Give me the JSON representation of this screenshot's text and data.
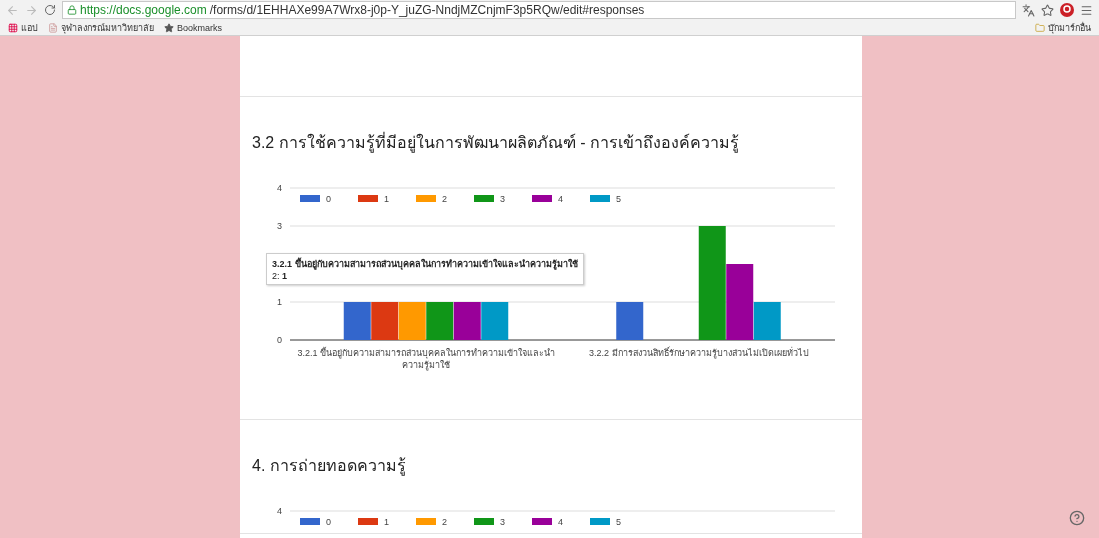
{
  "browser": {
    "url_host": "https://docs.google.com",
    "url_path": "/forms/d/1EHHAXe99A7Wrx8-j0p-Y_juZG-NndjMZCnjmF3p5RQw/edit#responses",
    "bookmarks": [
      {
        "kind": "apps",
        "label": "แอป"
      },
      {
        "kind": "page",
        "label": "จุฬาลงกรณ์มหาวิทยาลัย"
      },
      {
        "kind": "star",
        "label": "Bookmarks"
      }
    ],
    "other_bookmarks": "บุ๊กมาร์กอื่น"
  },
  "sections": [
    {
      "title": "3.2 การใช้ความรู้ที่มีอยู่ในการพัฒนาผลิตภัณฑ์ - การเข้าถึงองค์ความรู้",
      "chart_data": {
        "type": "bar",
        "legend": "top",
        "categories": [
          "3.2.1 ขึ้นอยู่กับความสามารถส่วนบุคคลในการทำความเข้าใจและนำความรู้มาใช้",
          "3.2.2 มีการสงวนสิทธิ์รักษาความรู้บางส่วนไม่เปิดเผยทั่วไป"
        ],
        "ylim": [
          0,
          4
        ],
        "yticks": [
          0,
          1,
          3,
          4
        ],
        "series": [
          {
            "name": "0",
            "color": "#3366cc",
            "values": [
              1,
              1
            ]
          },
          {
            "name": "1",
            "color": "#dc3912",
            "values": [
              1,
              0
            ]
          },
          {
            "name": "2",
            "color": "#ff9900",
            "values": [
              1,
              0
            ]
          },
          {
            "name": "3",
            "color": "#109618",
            "values": [
              1,
              3
            ]
          },
          {
            "name": "4",
            "color": "#990099",
            "values": [
              1,
              2
            ]
          },
          {
            "name": "5",
            "color": "#0099c6",
            "values": [
              1,
              1
            ]
          }
        ]
      },
      "tooltip": {
        "title": "3.2.1 ขึ้นอยู่กับความสามารถส่วนบุคคลในการทำความเข้าใจและนำความรู้มาใช้",
        "body": "2: **1**"
      }
    },
    {
      "title": "4. การถ่ายทอดความรู้",
      "chart_preview": {
        "top_tick": "4",
        "legend": [
          {
            "name": "0",
            "color": "#3366cc"
          },
          {
            "name": "1",
            "color": "#dc3912"
          },
          {
            "name": "2",
            "color": "#ff9900"
          },
          {
            "name": "3",
            "color": "#109618"
          },
          {
            "name": "4",
            "color": "#990099"
          },
          {
            "name": "5",
            "color": "#0099c6"
          }
        ]
      }
    }
  ]
}
